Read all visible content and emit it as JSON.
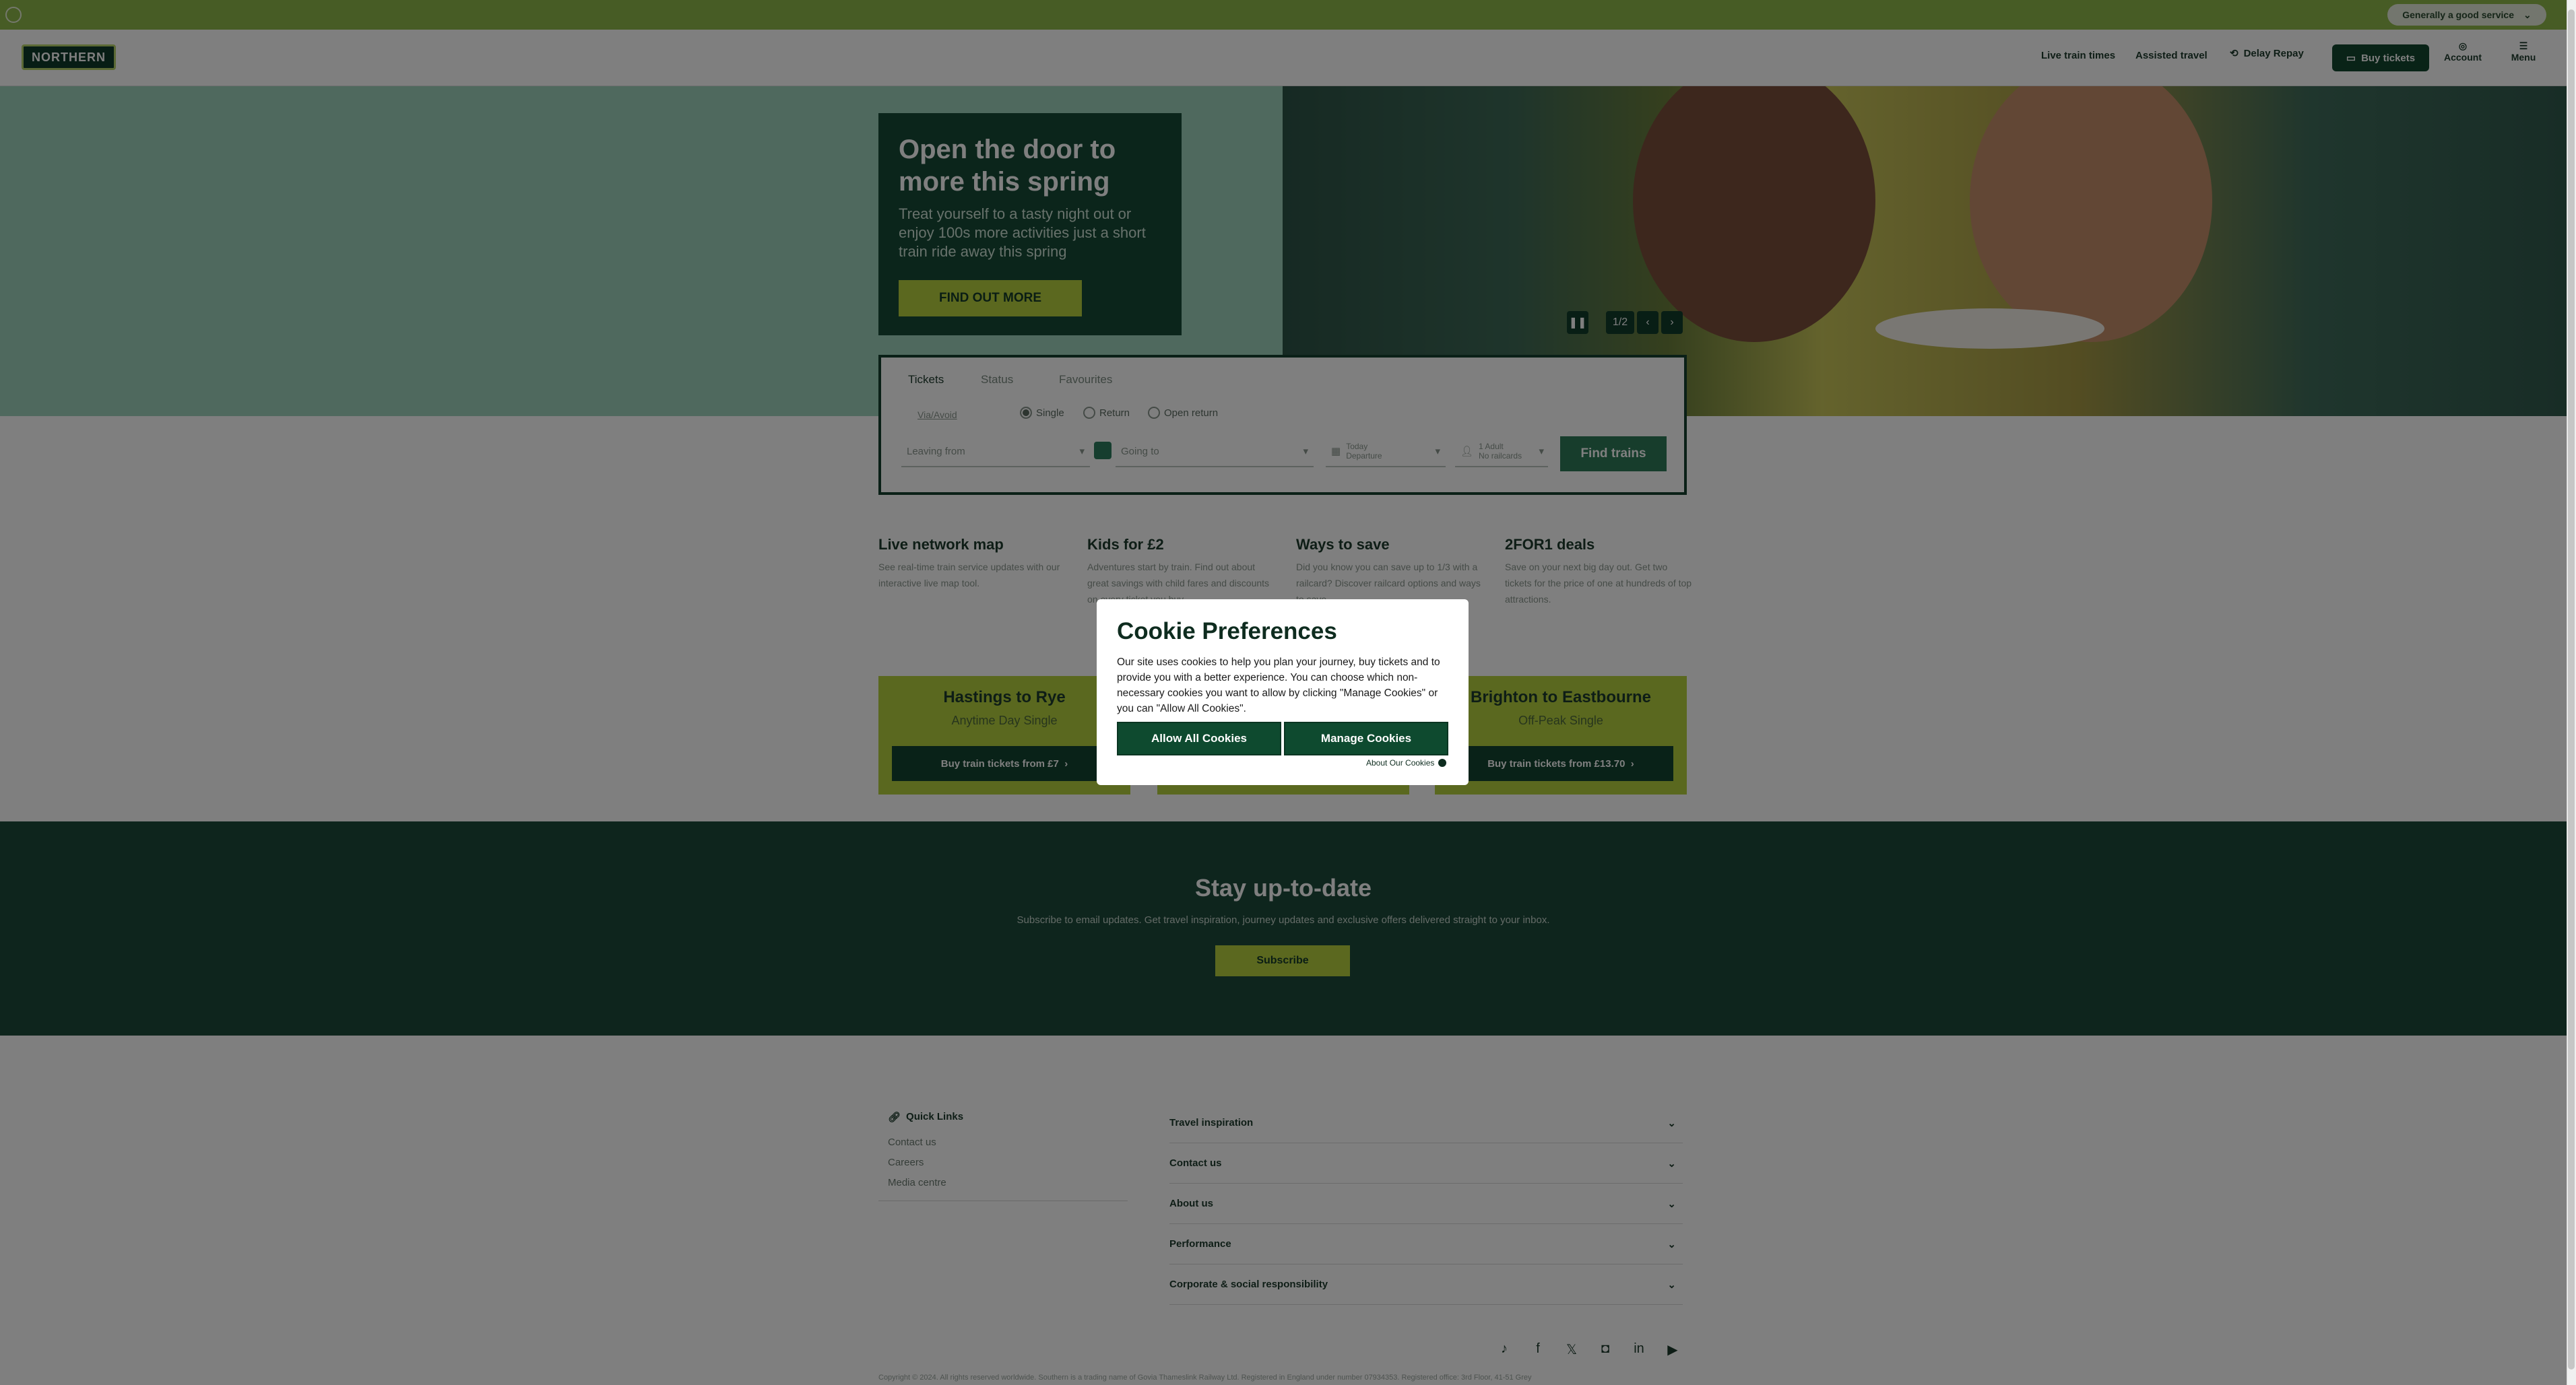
{
  "topbar": {
    "pill_label": "Generally a good service"
  },
  "header": {
    "logo_text": "NORTHERN",
    "nav": {
      "live_train_times": "Live train times",
      "assisted_travel": "Assisted travel",
      "delay_repay": "Delay Repay",
      "buy_tickets": "Buy tickets",
      "account": "Account",
      "menu": "Menu"
    }
  },
  "hero": {
    "title": "Open the door to more this spring",
    "body": "Treat yourself to a tasty night out or enjoy 100s more activities just a short train ride away this spring",
    "cta": "FIND OUT MORE",
    "pager": "1/2"
  },
  "planner": {
    "tabs": [
      "Tickets",
      "Status",
      "Favourites"
    ],
    "via_label": "Via/Avoid",
    "journey_types": [
      "Single",
      "Return",
      "Open return"
    ],
    "selected_journey": "Single",
    "leaving_from": "Leaving from",
    "going_to": "Going to",
    "date_label": "Today",
    "date_sub": "Departure",
    "passengers_label": "1 Adult",
    "passengers_sub": "No railcards",
    "find_trains": "Find trains"
  },
  "info_blocks": [
    {
      "title": "Live network map",
      "text": "See real-time train service updates with our interactive live map tool."
    },
    {
      "title": "Kids for £2",
      "text": "Adventures start by train. Find out about great savings with child fares and discounts on every ticket you buy."
    },
    {
      "title": "Ways to save",
      "text": "Did you know you can save up to 1/3 with a railcard? Discover railcard options and ways to save."
    },
    {
      "title": "2FOR1 deals",
      "text": "Save on your next big day out. Get two tickets for the price of one at hundreds of top attractions."
    }
  ],
  "offers": [
    {
      "route": "Hastings to Rye",
      "ticket": "Anytime Day Single",
      "button": "Buy train tickets from £7"
    },
    {
      "route": "",
      "ticket": "",
      "button": ""
    },
    {
      "route": "Brighton to Eastbourne",
      "ticket": "Off-Peak Single",
      "button": "Buy train tickets from £13.70"
    }
  ],
  "stay": {
    "title": "Stay up-to-date",
    "text": "Subscribe to email updates. Get travel inspiration, journey updates and exclusive offers delivered straight to your inbox.",
    "button": "Subscribe"
  },
  "footer": {
    "quick_links_title": "Quick Links",
    "quick_links": [
      "Contact us",
      "Careers",
      "Media centre"
    ],
    "accordion": [
      "Travel inspiration",
      "Contact us",
      "About us",
      "Performance",
      "Corporate & social responsibility"
    ],
    "copyright": "Copyright © 2024. All rights reserved worldwide. Southern is a trading name of Govia Thameslink Railway Ltd. Registered in England under number 07934353. Registered office: 3rd Floor, 41-51 Grey"
  },
  "cookie": {
    "title": "Cookie Preferences",
    "text": "Our site uses cookies to help you plan your journey, buy tickets and to provide you with a better experience. You can choose which non-necessary cookies you want to allow by clicking \"Manage Cookies\" or you can \"Allow All Cookies\".",
    "allow_all": "Allow All Cookies",
    "manage": "Manage Cookies",
    "about": "About Our Cookies"
  },
  "colors": {
    "brand_dark": "#0e4a2f",
    "accent_lime": "#b7d13f",
    "hero_mint": "#9fd3bd"
  }
}
